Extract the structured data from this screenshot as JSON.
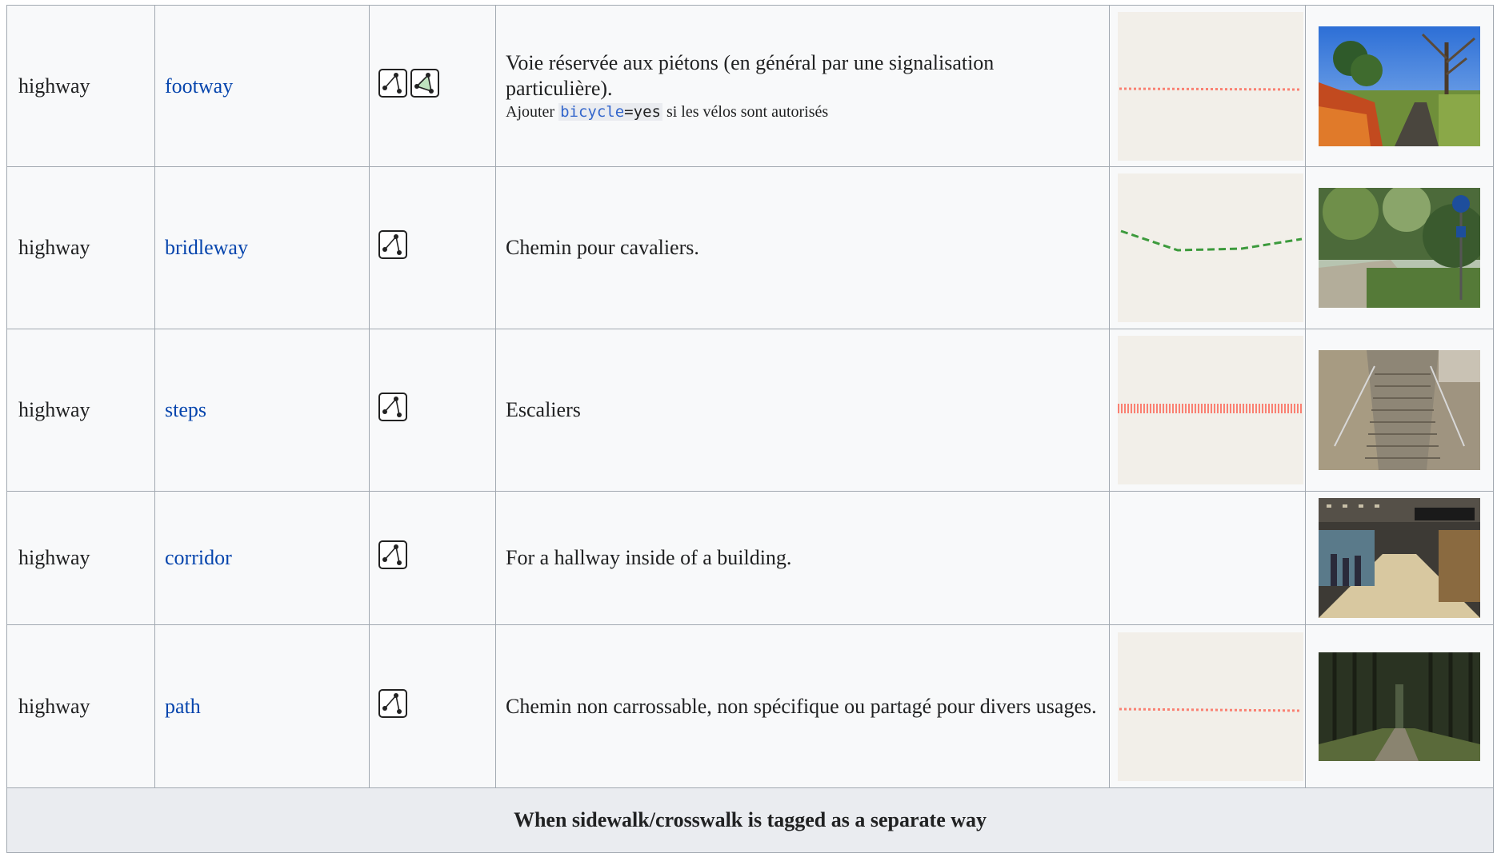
{
  "rows": [
    {
      "key": "highway",
      "value": "footway",
      "element_icons": [
        "way-icon",
        "area-icon"
      ],
      "description": "Voie réservée aux piétons (en général par une signalisation particulière).",
      "note": {
        "prefix": "Ajouter",
        "code_key": "bicycle",
        "code_eq": "=",
        "code_val": "yes",
        "suffix": "si les vélos sont autorisés"
      },
      "rendering": {
        "style": "dotted",
        "color": "#fa8072"
      },
      "photo": "footway-photo"
    },
    {
      "key": "highway",
      "value": "bridleway",
      "element_icons": [
        "way-icon"
      ],
      "description": "Chemin pour cavaliers.",
      "rendering": {
        "style": "dashed",
        "color": "#3c9a3c"
      },
      "photo": "bridleway-photo"
    },
    {
      "key": "highway",
      "value": "steps",
      "element_icons": [
        "way-icon"
      ],
      "description": "Escaliers",
      "rendering": {
        "style": "ladder",
        "color": "#fa8072"
      },
      "photo": "steps-photo"
    },
    {
      "key": "highway",
      "value": "corridor",
      "element_icons": [
        "way-icon"
      ],
      "description": "For a hallway inside of a building.",
      "rendering": null,
      "photo": "corridor-photo"
    },
    {
      "key": "highway",
      "value": "path",
      "element_icons": [
        "way-icon"
      ],
      "description": "Chemin non carrossable, non spécifique ou partagé pour divers usages.",
      "rendering": {
        "style": "dotted",
        "color": "#fa8072"
      },
      "photo": "path-photo"
    }
  ],
  "footer_title": "When sidewalk/crosswalk is tagged as a separate way"
}
